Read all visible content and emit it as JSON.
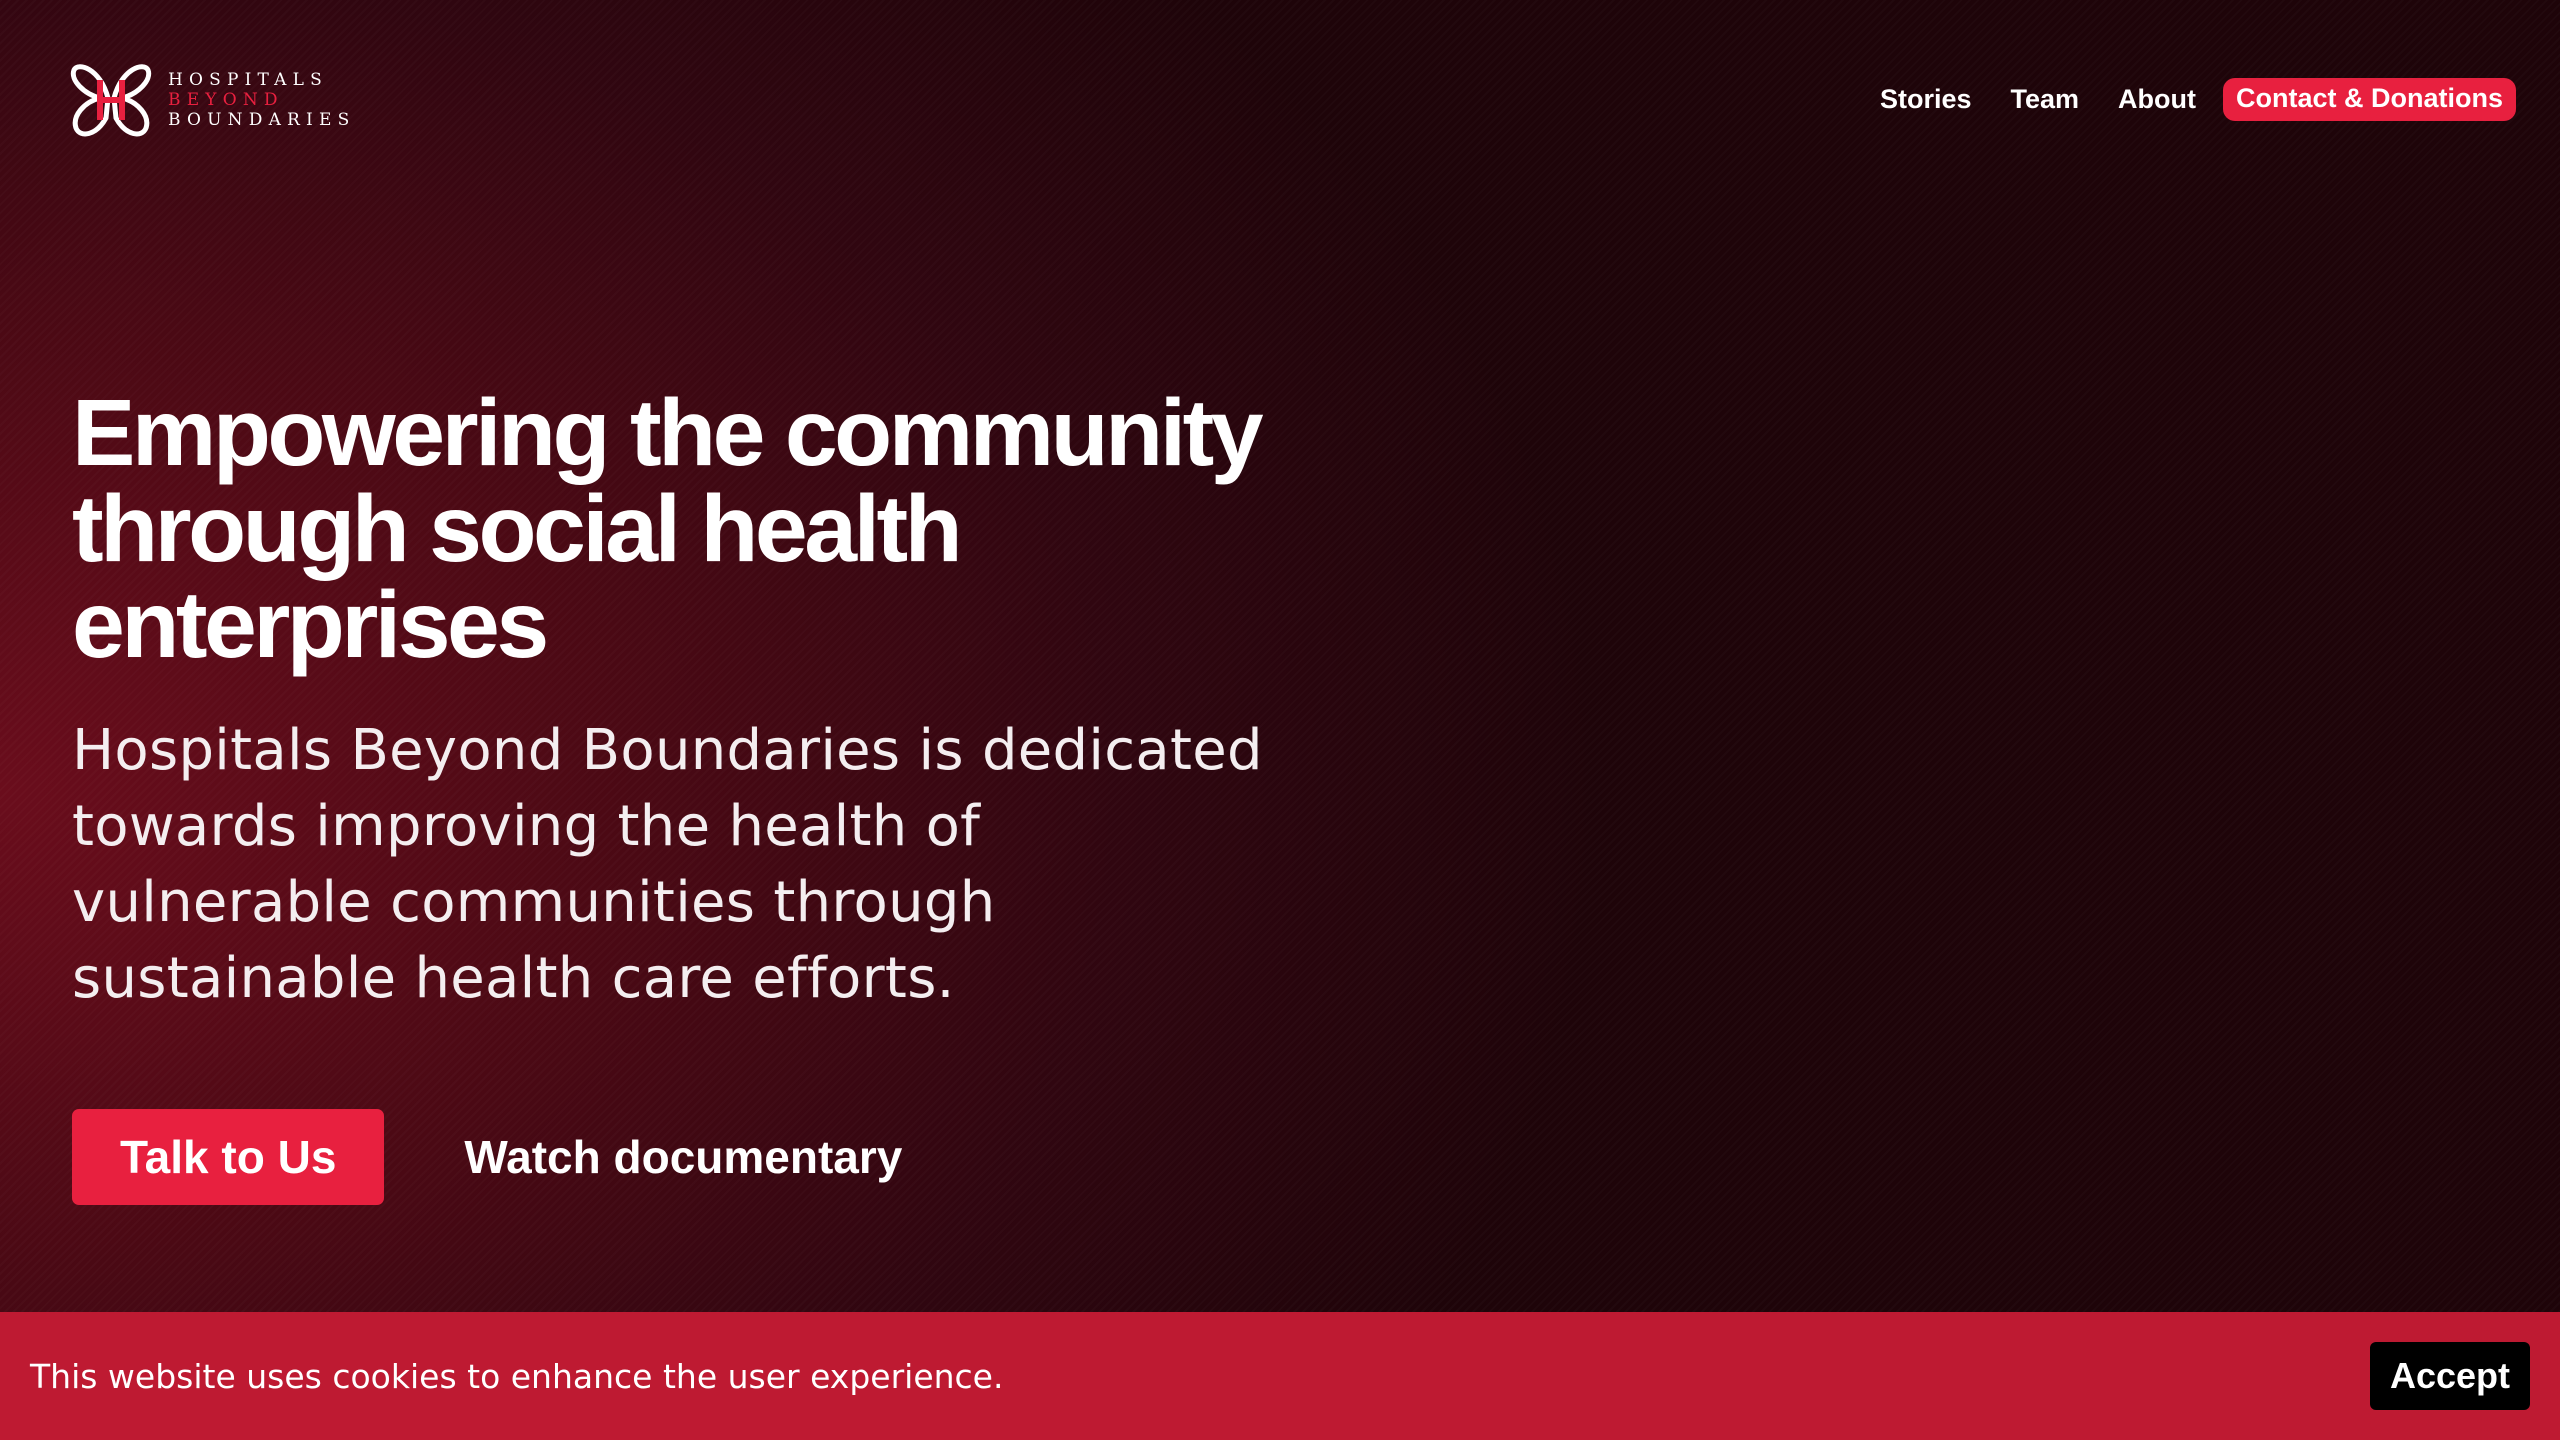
{
  "brand": {
    "logo_line1": "HOSPITALS",
    "logo_line2": "BEYOND",
    "logo_line3": "BOUNDARIES",
    "accent_color": "#e8203f"
  },
  "nav": {
    "items": [
      {
        "label": "Stories"
      },
      {
        "label": "Team"
      },
      {
        "label": "About"
      }
    ],
    "cta_label": "Contact & Donations"
  },
  "hero": {
    "title": "Empowering the community through social health enterprises",
    "subtitle": "Hospitals Beyond Boundaries is dedicated towards improving the health of vulnerable communities through sustainable health care efforts.",
    "primary_button": "Talk to Us",
    "secondary_link": "Watch documentary"
  },
  "cookie_banner": {
    "message": "This website uses cookies to enhance the user experience.",
    "accept_label": "Accept",
    "background_color": "#be1a32"
  }
}
